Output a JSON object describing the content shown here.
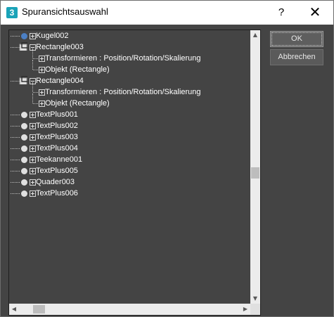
{
  "window": {
    "title": "Spuransichtsauswahl",
    "app_icon_glyph": "3",
    "help_glyph": "?",
    "close_glyph": "✕"
  },
  "buttons": {
    "ok": "OK",
    "cancel": "Abbrechen"
  },
  "tree": {
    "items": [
      {
        "label": "Kugel002",
        "type": "object",
        "dot_color": "#4b7fc4",
        "expanded": false,
        "level": 0
      },
      {
        "label": "Rectangle003",
        "type": "shape",
        "expanded": true,
        "level": 0
      },
      {
        "label": "Transformieren : Position/Rotation/Skalierung",
        "type": "track",
        "expanded": false,
        "level": 1
      },
      {
        "label": "Objekt (Rectangle)",
        "type": "track",
        "expanded": false,
        "level": 1
      },
      {
        "label": "Rectangle004",
        "type": "shape",
        "expanded": true,
        "level": 0
      },
      {
        "label": "Transformieren : Position/Rotation/Skalierung",
        "type": "track",
        "expanded": false,
        "level": 1
      },
      {
        "label": "Objekt (Rectangle)",
        "type": "track",
        "expanded": false,
        "level": 1
      },
      {
        "label": "TextPlus001",
        "type": "object",
        "dot_color": "#e0e0e0",
        "expanded": false,
        "level": 0
      },
      {
        "label": "TextPlus002",
        "type": "object",
        "dot_color": "#e0e0e0",
        "expanded": false,
        "level": 0
      },
      {
        "label": "TextPlus003",
        "type": "object",
        "dot_color": "#e0e0e0",
        "expanded": false,
        "level": 0
      },
      {
        "label": "TextPlus004",
        "type": "object",
        "dot_color": "#e0e0e0",
        "expanded": false,
        "level": 0
      },
      {
        "label": "Teekanne001",
        "type": "object",
        "dot_color": "#e0e0e0",
        "expanded": false,
        "level": 0
      },
      {
        "label": "TextPlus005",
        "type": "object",
        "dot_color": "#e0e0e0",
        "expanded": false,
        "level": 0
      },
      {
        "label": "Quader003",
        "type": "object",
        "dot_color": "#e0e0e0",
        "expanded": false,
        "level": 0
      },
      {
        "label": "TextPlus006",
        "type": "object",
        "dot_color": "#e0e0e0",
        "expanded": false,
        "level": 0
      }
    ]
  },
  "scrollbars": {
    "up_glyph": "▲",
    "down_glyph": "▼",
    "left_glyph": "◀",
    "right_glyph": "▶"
  }
}
